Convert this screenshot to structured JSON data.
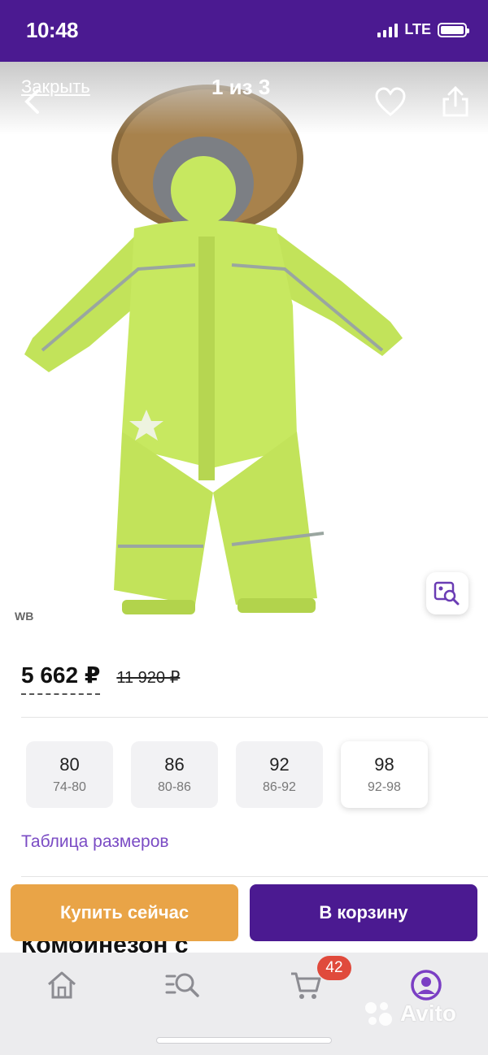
{
  "status_bar": {
    "time": "10:48",
    "network": "LTE"
  },
  "gallery": {
    "close_label": "Закрыть",
    "counter": "1 из 3",
    "source_label": "WB",
    "icons": [
      "chevron-left-icon",
      "heart-icon",
      "share-icon",
      "visual-search-icon"
    ]
  },
  "price": {
    "current": "5 662 ₽",
    "old": "11 920 ₽"
  },
  "sizes": [
    {
      "size": "80",
      "range": "74-80",
      "selected": false
    },
    {
      "size": "86",
      "range": "80-86",
      "selected": false
    },
    {
      "size": "92",
      "range": "86-92",
      "selected": false
    },
    {
      "size": "98",
      "range": "92-98",
      "selected": true
    }
  ],
  "size_table_link": "Таблица размеров",
  "title_peek": "Комбинезон с",
  "actions": {
    "buy_now": "Купить сейчас",
    "add_to_cart": "В корзину"
  },
  "tab_bar": {
    "items": [
      "home-icon",
      "catalog-search-icon",
      "cart-icon",
      "profile-icon"
    ],
    "cart_badge": "42",
    "watermark": "Avito"
  },
  "colors": {
    "brand_purple": "#4b1a91",
    "buy_orange": "#e9a447",
    "link_purple": "#7a4bc4",
    "badge_red": "#e04a3c",
    "product_green": "#c7e860"
  }
}
